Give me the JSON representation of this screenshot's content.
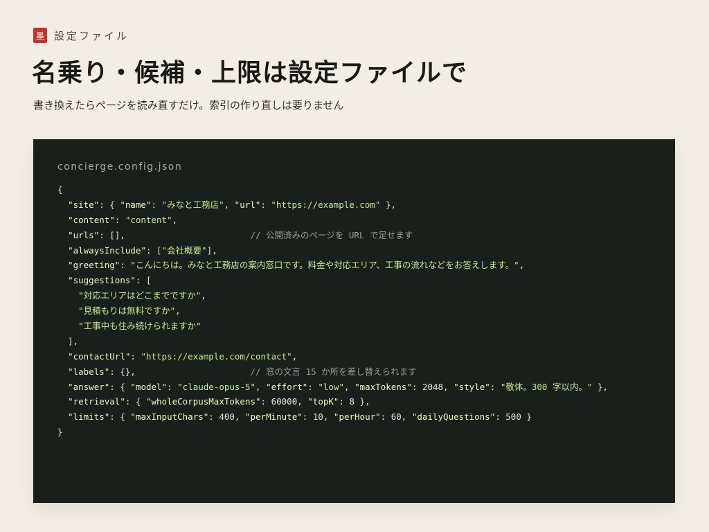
{
  "header": {
    "logo_text": "墨",
    "section_label": "設定ファイル",
    "title": "名乗り・候補・上限は設定ファイルで",
    "subtitle": "書き換えたらページを読み直すだけ。索引の作り直しは要りません"
  },
  "code_panel": {
    "file_name": "concierge.config.json",
    "lines": [
      [
        {
          "t": "p",
          "v": "{"
        }
      ],
      [
        {
          "t": "p",
          "v": "  "
        },
        {
          "t": "k",
          "v": "\"site\""
        },
        {
          "t": "p",
          "v": ": { "
        },
        {
          "t": "k",
          "v": "\"name\""
        },
        {
          "t": "p",
          "v": ": "
        },
        {
          "t": "s",
          "v": "\"みなと工務店\""
        },
        {
          "t": "p",
          "v": ", "
        },
        {
          "t": "k",
          "v": "\"url\""
        },
        {
          "t": "p",
          "v": ": "
        },
        {
          "t": "s",
          "v": "\"https://example.com\""
        },
        {
          "t": "p",
          "v": " },"
        }
      ],
      [
        {
          "t": "p",
          "v": "  "
        },
        {
          "t": "k",
          "v": "\"content\""
        },
        {
          "t": "p",
          "v": ": "
        },
        {
          "t": "s",
          "v": "\"content\""
        },
        {
          "t": "p",
          "v": ","
        }
      ],
      [
        {
          "t": "p",
          "v": "  "
        },
        {
          "t": "k",
          "v": "\"urls\""
        },
        {
          "t": "p",
          "v": ": [],                        "
        },
        {
          "t": "c",
          "v": "// 公開済みのページを URL で足せます"
        }
      ],
      [
        {
          "t": "p",
          "v": "  "
        },
        {
          "t": "k",
          "v": "\"alwaysInclude\""
        },
        {
          "t": "p",
          "v": ": ["
        },
        {
          "t": "s",
          "v": "\"会社概要\""
        },
        {
          "t": "p",
          "v": "],"
        }
      ],
      [
        {
          "t": "p",
          "v": "  "
        },
        {
          "t": "k",
          "v": "\"greeting\""
        },
        {
          "t": "p",
          "v": ": "
        },
        {
          "t": "s",
          "v": "\"こんにちは。みなと工務店の案内窓口です。料金や対応エリア、工事の流れなどをお答えします。\""
        },
        {
          "t": "p",
          "v": ","
        }
      ],
      [
        {
          "t": "p",
          "v": "  "
        },
        {
          "t": "k",
          "v": "\"suggestions\""
        },
        {
          "t": "p",
          "v": ": ["
        }
      ],
      [
        {
          "t": "p",
          "v": "    "
        },
        {
          "t": "s",
          "v": "\"対応エリアはどこまでですか\""
        },
        {
          "t": "p",
          "v": ","
        }
      ],
      [
        {
          "t": "p",
          "v": "    "
        },
        {
          "t": "s",
          "v": "\"見積もりは無料ですか\""
        },
        {
          "t": "p",
          "v": ","
        }
      ],
      [
        {
          "t": "p",
          "v": "    "
        },
        {
          "t": "s",
          "v": "\"工事中も住み続けられますか\""
        }
      ],
      [
        {
          "t": "p",
          "v": "  ],"
        }
      ],
      [
        {
          "t": "p",
          "v": "  "
        },
        {
          "t": "k",
          "v": "\"contactUrl\""
        },
        {
          "t": "p",
          "v": ": "
        },
        {
          "t": "s",
          "v": "\"https://example.com/contact\""
        },
        {
          "t": "p",
          "v": ","
        }
      ],
      [
        {
          "t": "p",
          "v": "  "
        },
        {
          "t": "k",
          "v": "\"labels\""
        },
        {
          "t": "p",
          "v": ": {},                      "
        },
        {
          "t": "c",
          "v": "// 窓の文言 15 か所を差し替えられます"
        }
      ],
      [
        {
          "t": "p",
          "v": "  "
        },
        {
          "t": "k",
          "v": "\"answer\""
        },
        {
          "t": "p",
          "v": ": { "
        },
        {
          "t": "k",
          "v": "\"model\""
        },
        {
          "t": "p",
          "v": ": "
        },
        {
          "t": "s",
          "v": "\"claude-opus-5\""
        },
        {
          "t": "p",
          "v": ", "
        },
        {
          "t": "k",
          "v": "\"effort\""
        },
        {
          "t": "p",
          "v": ": "
        },
        {
          "t": "s",
          "v": "\"low\""
        },
        {
          "t": "p",
          "v": ", "
        },
        {
          "t": "k",
          "v": "\"maxTokens\""
        },
        {
          "t": "p",
          "v": ": 2048, "
        },
        {
          "t": "k",
          "v": "\"style\""
        },
        {
          "t": "p",
          "v": ": "
        },
        {
          "t": "s",
          "v": "\"敬体。300 字以内。\""
        },
        {
          "t": "p",
          "v": " },"
        }
      ],
      [
        {
          "t": "p",
          "v": "  "
        },
        {
          "t": "k",
          "v": "\"retrieval\""
        },
        {
          "t": "p",
          "v": ": { "
        },
        {
          "t": "k",
          "v": "\"wholeCorpusMaxTokens\""
        },
        {
          "t": "p",
          "v": ": 60000, "
        },
        {
          "t": "k",
          "v": "\"topK\""
        },
        {
          "t": "p",
          "v": ": 8 },"
        }
      ],
      [
        {
          "t": "p",
          "v": "  "
        },
        {
          "t": "k",
          "v": "\"limits\""
        },
        {
          "t": "p",
          "v": ": { "
        },
        {
          "t": "k",
          "v": "\"maxInputChars\""
        },
        {
          "t": "p",
          "v": ": 400, "
        },
        {
          "t": "k",
          "v": "\"perMinute\""
        },
        {
          "t": "p",
          "v": ": 10, "
        },
        {
          "t": "k",
          "v": "\"perHour\""
        },
        {
          "t": "p",
          "v": ": 60, "
        },
        {
          "t": "k",
          "v": "\"dailyQuestions\""
        },
        {
          "t": "p",
          "v": ": 500 }"
        }
      ],
      [
        {
          "t": "p",
          "v": "}"
        }
      ]
    ]
  },
  "colors": {
    "background": "#f2eee7",
    "accent": "#c0342a",
    "code_background": "#1b1f1b",
    "code_key": "#f2f6c8",
    "code_string": "#c7ea9d",
    "code_comment": "#9a9d95"
  }
}
